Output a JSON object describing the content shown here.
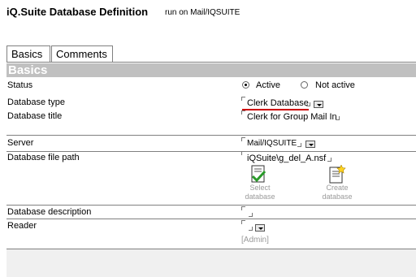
{
  "header": {
    "title": "iQ.Suite Database Definition",
    "subtitle": "run on Mail/IQSUITE"
  },
  "tabs": [
    {
      "label": "Basics"
    },
    {
      "label": "Comments"
    }
  ],
  "section": {
    "title": "Basics"
  },
  "fields": {
    "status": {
      "label": "Status",
      "options": [
        {
          "label": "Active",
          "selected": true
        },
        {
          "label": "Not active",
          "selected": false
        }
      ]
    },
    "database_type": {
      "label": "Database type",
      "value": "Clerk Database"
    },
    "database_title": {
      "label": "Database title",
      "value": "Clerk for Group Mail In"
    },
    "server": {
      "label": "Server",
      "value": "Mail/IQSUITE"
    },
    "database_file_path": {
      "label": "Database file path",
      "value": "iQSuite\\g_del_A.nsf",
      "actions": [
        {
          "label_line1": "Select",
          "label_line2": "database",
          "icon": "select-database-icon"
        },
        {
          "label_line1": "Create",
          "label_line2": "database",
          "icon": "create-database-icon"
        }
      ]
    },
    "database_description": {
      "label": "Database description",
      "value": ""
    },
    "reader": {
      "label": "Reader",
      "value": "",
      "hint": "[Admin]"
    }
  },
  "colors": {
    "accent_underline": "#cc0000",
    "section_header": "#c0c0c0",
    "disabled_text": "#9a9a9a"
  }
}
